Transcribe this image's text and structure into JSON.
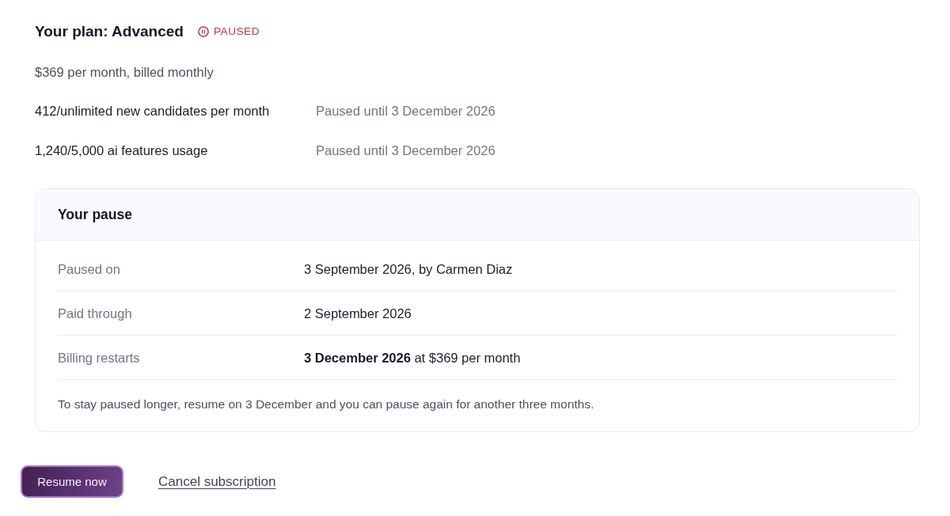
{
  "plan": {
    "title": "Your plan: Advanced",
    "status": {
      "kind": "paused",
      "label": "PAUSED"
    },
    "price": "$369 per month, billed monthly",
    "usage": [
      {
        "amount": "412/unlimited new candidates per month",
        "note": "Paused until 3 December 2026"
      },
      {
        "amount": "1,240/5,000 ai features usage",
        "note": "Paused until 3 December 2026"
      }
    ]
  },
  "pause_card": {
    "title": "Your pause",
    "rows": [
      {
        "label": "Paused on",
        "value": "3 September 2026, by Carmen Diaz"
      },
      {
        "label": "Paid through",
        "value": "2 September 2026"
      },
      {
        "label": "Billing restarts",
        "value": "**3 December 2026** at $369 per month"
      }
    ],
    "note": "To stay paused longer, resume on 3 December and you can pause again for another three months."
  },
  "actions": [
    {
      "kind": "primary",
      "label": "Resume now"
    },
    {
      "kind": "link",
      "label": "Cancel subscription"
    }
  ]
}
